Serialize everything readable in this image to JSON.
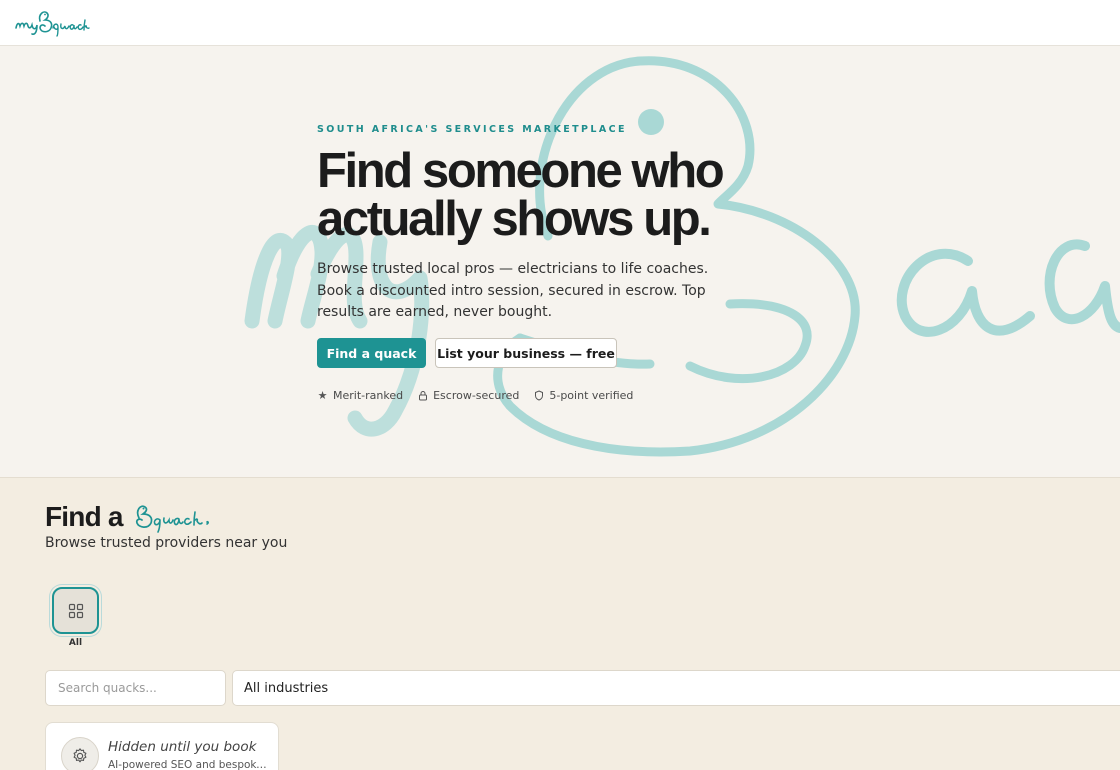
{
  "colors": {
    "accent": "#1e9393",
    "hero_bg": "#f6f3ee",
    "page_bg": "#f3ede1",
    "watermark": "#a9d8d5"
  },
  "nav": {
    "logo_icon": "myquack-logo"
  },
  "hero": {
    "eyebrow": "SOUTH AFRICA'S SERVICES MARKETPLACE",
    "headline_line1": "Find someone who",
    "headline_line2": "actually shows up.",
    "lede": "Browse trusted local pros — electricians to life coaches. Book a discounted intro session, secured in escrow. Top results are earned, never bought.",
    "primary_cta": "Find a quack",
    "secondary_cta": "List your business — free",
    "badges": [
      {
        "icon": "star-icon",
        "label": "Merit-ranked"
      },
      {
        "icon": "lock-icon",
        "label": "Escrow-secured"
      },
      {
        "icon": "shield-icon",
        "label": "5-point verified"
      }
    ]
  },
  "find": {
    "title_prefix": "Find a",
    "subtitle": "Browse trusted providers near you",
    "categories": [
      {
        "icon": "grid-icon",
        "label": "All",
        "selected": true
      }
    ],
    "search_placeholder": "Search quacks...",
    "industry_select": "All industries"
  },
  "cards": [
    {
      "icon": "gear-icon",
      "title": "Hidden until you book",
      "description": "AI-powered SEO and bespoke..."
    }
  ]
}
